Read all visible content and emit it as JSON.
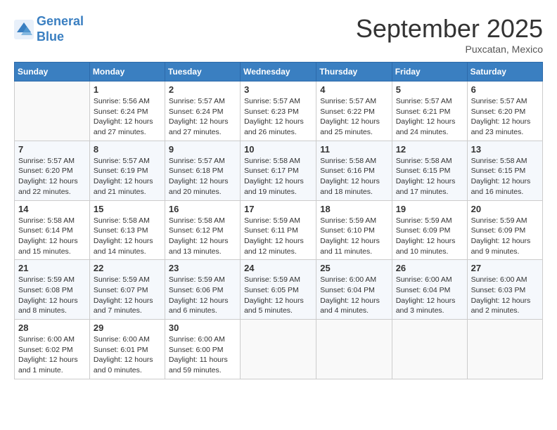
{
  "header": {
    "logo_line1": "General",
    "logo_line2": "Blue",
    "month_title": "September 2025",
    "location": "Puxcatan, Mexico"
  },
  "weekdays": [
    "Sunday",
    "Monday",
    "Tuesday",
    "Wednesday",
    "Thursday",
    "Friday",
    "Saturday"
  ],
  "weeks": [
    [
      {
        "day": null
      },
      {
        "day": 1,
        "sunrise": "5:56 AM",
        "sunset": "6:24 PM",
        "daylight": "12 hours and 27 minutes."
      },
      {
        "day": 2,
        "sunrise": "5:57 AM",
        "sunset": "6:24 PM",
        "daylight": "12 hours and 27 minutes."
      },
      {
        "day": 3,
        "sunrise": "5:57 AM",
        "sunset": "6:23 PM",
        "daylight": "12 hours and 26 minutes."
      },
      {
        "day": 4,
        "sunrise": "5:57 AM",
        "sunset": "6:22 PM",
        "daylight": "12 hours and 25 minutes."
      },
      {
        "day": 5,
        "sunrise": "5:57 AM",
        "sunset": "6:21 PM",
        "daylight": "12 hours and 24 minutes."
      },
      {
        "day": 6,
        "sunrise": "5:57 AM",
        "sunset": "6:20 PM",
        "daylight": "12 hours and 23 minutes."
      }
    ],
    [
      {
        "day": 7,
        "sunrise": "5:57 AM",
        "sunset": "6:20 PM",
        "daylight": "12 hours and 22 minutes."
      },
      {
        "day": 8,
        "sunrise": "5:57 AM",
        "sunset": "6:19 PM",
        "daylight": "12 hours and 21 minutes."
      },
      {
        "day": 9,
        "sunrise": "5:57 AM",
        "sunset": "6:18 PM",
        "daylight": "12 hours and 20 minutes."
      },
      {
        "day": 10,
        "sunrise": "5:58 AM",
        "sunset": "6:17 PM",
        "daylight": "12 hours and 19 minutes."
      },
      {
        "day": 11,
        "sunrise": "5:58 AM",
        "sunset": "6:16 PM",
        "daylight": "12 hours and 18 minutes."
      },
      {
        "day": 12,
        "sunrise": "5:58 AM",
        "sunset": "6:15 PM",
        "daylight": "12 hours and 17 minutes."
      },
      {
        "day": 13,
        "sunrise": "5:58 AM",
        "sunset": "6:15 PM",
        "daylight": "12 hours and 16 minutes."
      }
    ],
    [
      {
        "day": 14,
        "sunrise": "5:58 AM",
        "sunset": "6:14 PM",
        "daylight": "12 hours and 15 minutes."
      },
      {
        "day": 15,
        "sunrise": "5:58 AM",
        "sunset": "6:13 PM",
        "daylight": "12 hours and 14 minutes."
      },
      {
        "day": 16,
        "sunrise": "5:58 AM",
        "sunset": "6:12 PM",
        "daylight": "12 hours and 13 minutes."
      },
      {
        "day": 17,
        "sunrise": "5:59 AM",
        "sunset": "6:11 PM",
        "daylight": "12 hours and 12 minutes."
      },
      {
        "day": 18,
        "sunrise": "5:59 AM",
        "sunset": "6:10 PM",
        "daylight": "12 hours and 11 minutes."
      },
      {
        "day": 19,
        "sunrise": "5:59 AM",
        "sunset": "6:09 PM",
        "daylight": "12 hours and 10 minutes."
      },
      {
        "day": 20,
        "sunrise": "5:59 AM",
        "sunset": "6:09 PM",
        "daylight": "12 hours and 9 minutes."
      }
    ],
    [
      {
        "day": 21,
        "sunrise": "5:59 AM",
        "sunset": "6:08 PM",
        "daylight": "12 hours and 8 minutes."
      },
      {
        "day": 22,
        "sunrise": "5:59 AM",
        "sunset": "6:07 PM",
        "daylight": "12 hours and 7 minutes."
      },
      {
        "day": 23,
        "sunrise": "5:59 AM",
        "sunset": "6:06 PM",
        "daylight": "12 hours and 6 minutes."
      },
      {
        "day": 24,
        "sunrise": "5:59 AM",
        "sunset": "6:05 PM",
        "daylight": "12 hours and 5 minutes."
      },
      {
        "day": 25,
        "sunrise": "6:00 AM",
        "sunset": "6:04 PM",
        "daylight": "12 hours and 4 minutes."
      },
      {
        "day": 26,
        "sunrise": "6:00 AM",
        "sunset": "6:04 PM",
        "daylight": "12 hours and 3 minutes."
      },
      {
        "day": 27,
        "sunrise": "6:00 AM",
        "sunset": "6:03 PM",
        "daylight": "12 hours and 2 minutes."
      }
    ],
    [
      {
        "day": 28,
        "sunrise": "6:00 AM",
        "sunset": "6:02 PM",
        "daylight": "12 hours and 1 minute."
      },
      {
        "day": 29,
        "sunrise": "6:00 AM",
        "sunset": "6:01 PM",
        "daylight": "12 hours and 0 minutes."
      },
      {
        "day": 30,
        "sunrise": "6:00 AM",
        "sunset": "6:00 PM",
        "daylight": "11 hours and 59 minutes."
      },
      {
        "day": null
      },
      {
        "day": null
      },
      {
        "day": null
      },
      {
        "day": null
      }
    ]
  ]
}
